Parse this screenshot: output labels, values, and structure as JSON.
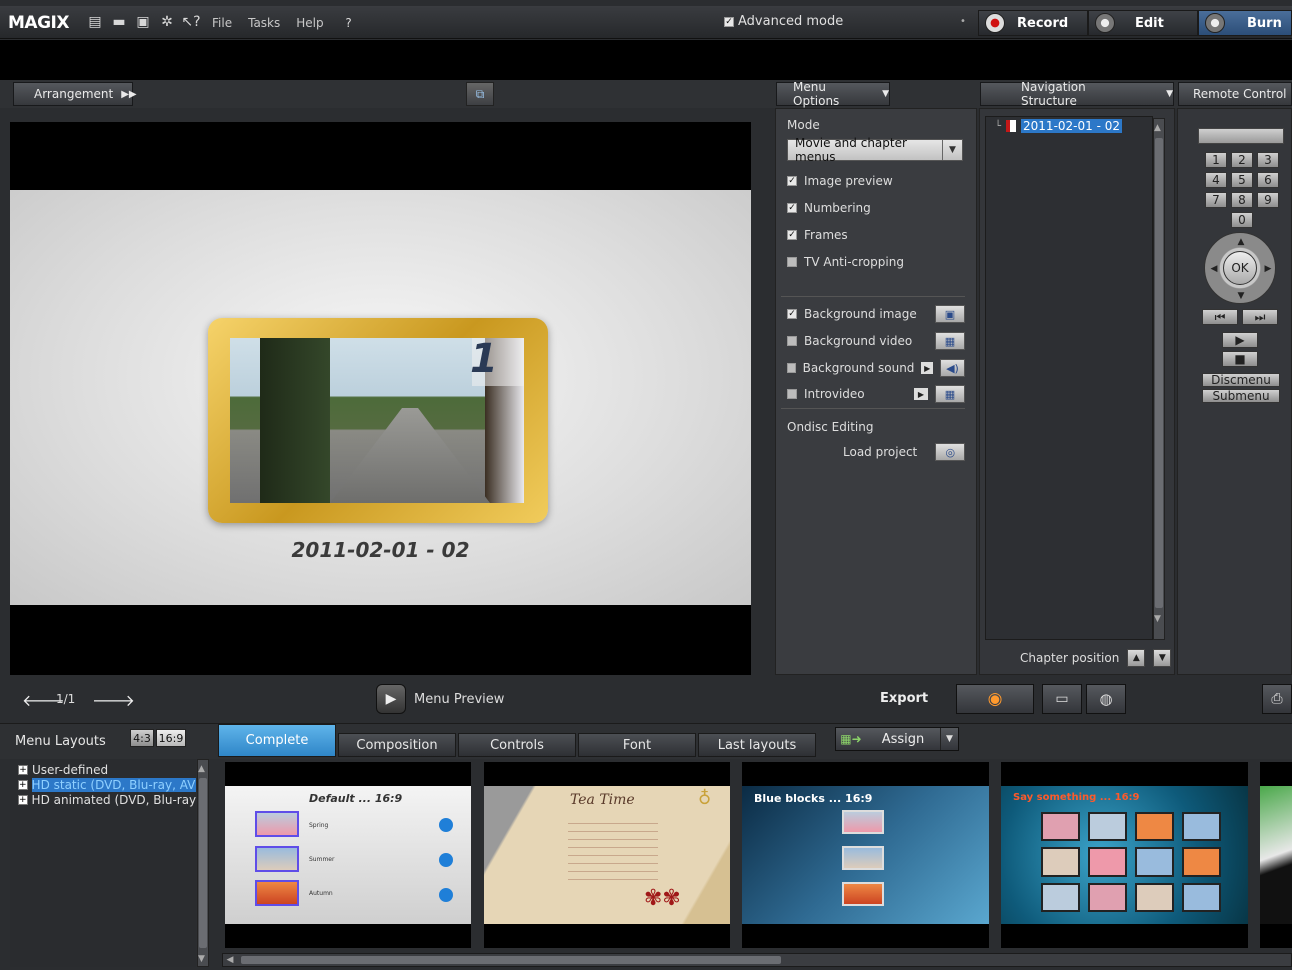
{
  "app": {
    "logo": "MAGIX",
    "menu": [
      "File",
      "Tasks",
      "Help"
    ],
    "advanced_mode_label": "Advanced mode",
    "modes": {
      "record": "Record",
      "edit": "Edit",
      "burn": "Burn"
    }
  },
  "arrangement": {
    "label": "Arrangement"
  },
  "menu_options": {
    "header": "Menu Options",
    "mode_label": "Mode",
    "mode_value": "Movie and chapter menus",
    "checkboxes": [
      {
        "label": "Image preview",
        "checked": true
      },
      {
        "label": "Numbering",
        "checked": true
      },
      {
        "label": "Frames",
        "checked": true
      },
      {
        "label": "TV Anti-cropping",
        "checked": false
      }
    ],
    "media": [
      {
        "label": "Background image",
        "checked": true
      },
      {
        "label": "Background video",
        "checked": false
      },
      {
        "label": "Background sound",
        "checked": false
      },
      {
        "label": "Introvideo",
        "checked": false
      }
    ],
    "ondisc_label": "Ondisc Editing",
    "load_project": "Load project"
  },
  "navigation": {
    "header": "Navigation Structure",
    "tree_item": "2011-02-01 - 02",
    "chapter_position": "Chapter position"
  },
  "remote": {
    "header": "Remote Control",
    "keys": [
      "1",
      "2",
      "3",
      "4",
      "5",
      "6",
      "7",
      "8",
      "9",
      "0"
    ],
    "ok": "OK",
    "discmenu": "Discmenu",
    "submenu": "Submenu"
  },
  "preview": {
    "chapter_number": "1",
    "chapter_title": "2011-02-01 - 02",
    "page": "1/1",
    "menu_preview_label": "Menu Preview"
  },
  "export": {
    "label": "Export"
  },
  "layouts": {
    "header": "Menu Layouts",
    "aspect": [
      "4:3",
      "16:9"
    ],
    "tabs": [
      "Complete",
      "Composition",
      "Controls",
      "Font",
      "Last layouts"
    ],
    "assign": "Assign",
    "tree": [
      "User-defined",
      "HD static (DVD, Blu-ray, AVC HD)",
      "HD animated (DVD, Blu-ray, AV"
    ],
    "thumbs": [
      {
        "title": "Default ... 16:9",
        "items": [
          "Spring",
          "Summer",
          "Autumn"
        ]
      },
      {
        "title": "Tea Time"
      },
      {
        "title": "Blue blocks ... 16:9"
      },
      {
        "title": "Say something ... 16:9"
      }
    ]
  }
}
